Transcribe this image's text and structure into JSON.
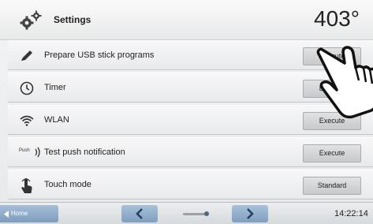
{
  "header": {
    "title": "Settings",
    "temperature": "403°"
  },
  "rows": [
    {
      "label": "Prepare USB stick programs",
      "button": "Execute",
      "icon": "pen-icon"
    },
    {
      "label": "Timer",
      "button": "Execute",
      "icon": "clock-icon"
    },
    {
      "label": "WLAN",
      "button": "Execute",
      "icon": "wifi-icon"
    },
    {
      "label": "Test push notification",
      "button": "Execute",
      "icon": "push-icon",
      "tag": "Push"
    },
    {
      "label": "Touch mode",
      "button": "Standard",
      "icon": "touch-hand-icon"
    }
  ],
  "footer": {
    "home_label": "Home",
    "time": "14:22:14"
  },
  "colors": {
    "nav_accent": "#8fabc8",
    "row_bg": "#efeff1"
  }
}
